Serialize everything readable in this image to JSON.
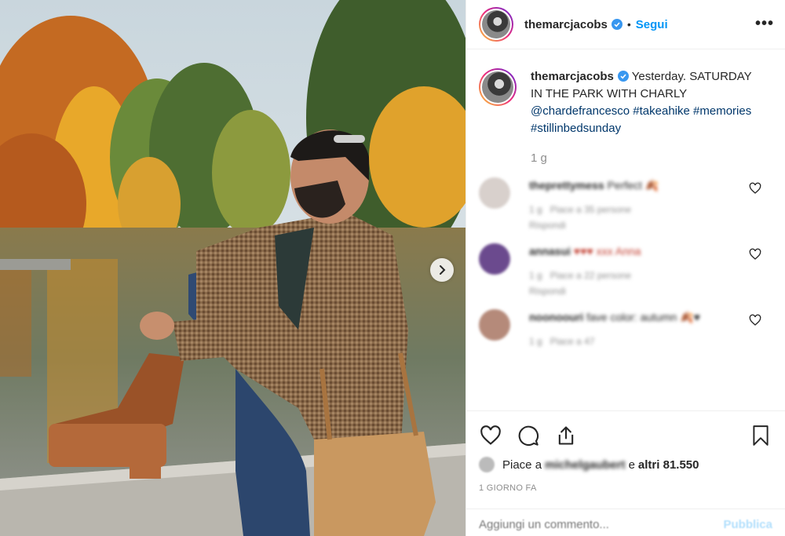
{
  "photo": {
    "alt_icon": "chevron-right-icon"
  },
  "header": {
    "username": "themarcjacobs",
    "separator": "•",
    "follow_label": "Segui",
    "more_label": "•••"
  },
  "caption": {
    "username": "themarcjacobs",
    "time_word": "Yesterday.",
    "text": "SATURDAY IN THE PARK WITH CHARLY",
    "mention": "@chardefrancesco",
    "hashtags": [
      "#takeahike",
      "#memories",
      "#stillinbedsunday"
    ],
    "age": "1 g"
  },
  "comments": [
    {
      "username": "theprettymess",
      "text": "Perfect 🍂",
      "age": "1 g",
      "likes": "Piace a 35 persone",
      "reply": "Rispondi",
      "avatar_color": "#d8d0cc"
    },
    {
      "username": "annasui",
      "text": "♥♥♥ xxx Anna",
      "age": "1 g",
      "likes": "Piace a 22 persone",
      "reply": "Rispondi",
      "avatar_color": "#6b4a8e"
    },
    {
      "username": "noonoouri",
      "text": "fave color: autumn 🍂♥",
      "age": "1 g",
      "likes": "Piace a 47",
      "reply": "",
      "avatar_color": "#b58a7a"
    }
  ],
  "actions": {
    "icons": [
      "heart-icon",
      "comment-icon",
      "share-icon",
      "bookmark-icon"
    ],
    "likes_prefix": "Piace a",
    "likes_user": "michelgaubert",
    "likes_and": "e",
    "likes_others": "altri 81.550",
    "date": "1 GIORNO FA"
  },
  "add_comment": {
    "placeholder": "Aggiungi un commento...",
    "publish_label": "Pubblica"
  },
  "colors": {
    "accent": "#0095f6",
    "text": "#262626",
    "muted": "#8e8e8e",
    "publish_disabled": "#b2dffc"
  }
}
